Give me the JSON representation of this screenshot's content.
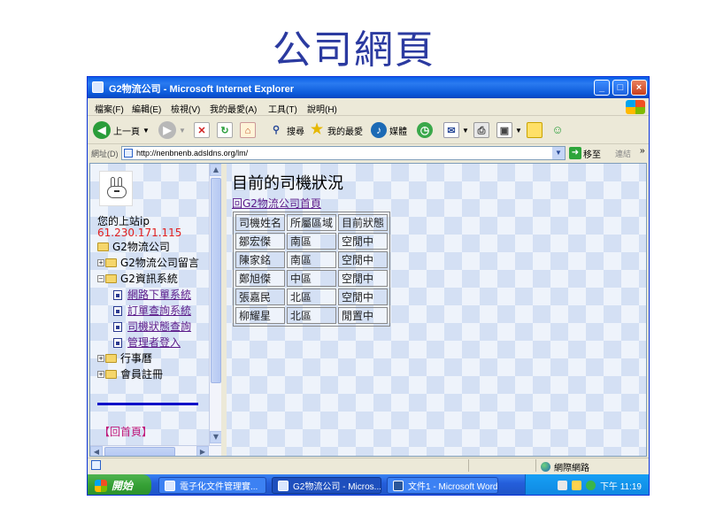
{
  "slide": {
    "title": "公司網頁"
  },
  "window": {
    "title": "G2物流公司 - Microsoft Internet Explorer"
  },
  "menu": [
    "檔案(F)",
    "編輯(E)",
    "檢視(V)",
    "我的最愛(A)",
    "工具(T)",
    "說明(H)"
  ],
  "toolbar": {
    "back": "上一頁",
    "search": "搜尋",
    "favorites": "我的最愛",
    "media": "媒體"
  },
  "address": {
    "label": "網址(D)",
    "url": "http://nenbnenb.adsldns.org/lm/",
    "go": "移至",
    "links": "連結"
  },
  "sidebar": {
    "ip_label": "您的上站ip",
    "ip_value": "61.230.171.115",
    "tree": {
      "root": "G2物流公司",
      "guestbook": "G2物流公司留言",
      "info": "G2資訊系統",
      "online_order": "網路下單系統",
      "order_query": "訂單查詢系統",
      "driver_status": "司機狀態查詢",
      "admin_login": "管理者登入",
      "calendar": "行事曆",
      "register": "會員註冊"
    },
    "home_link": "【回首頁】"
  },
  "main": {
    "heading": "目前的司機狀況",
    "back_link": "回G2物流公司首頁",
    "table": {
      "headers": [
        "司機姓名",
        "所屬區域",
        "目前狀態"
      ],
      "rows": [
        [
          "鄒宏傑",
          "南區",
          "空閒中"
        ],
        [
          "陳家銘",
          "南區",
          "空閒中"
        ],
        [
          "鄭旭傑",
          "中區",
          "空閒中"
        ],
        [
          "張嘉民",
          "北區",
          "空閒中"
        ],
        [
          "柳耀星",
          "北區",
          "閒置中"
        ]
      ]
    }
  },
  "status": {
    "zone": "網際網路"
  },
  "taskbar": {
    "start": "開始",
    "tasks": [
      "電子化文件管理實...",
      "G2物流公司 - Micros...",
      "文件1 - Microsoft Word"
    ],
    "clock": "下午 11:19"
  }
}
